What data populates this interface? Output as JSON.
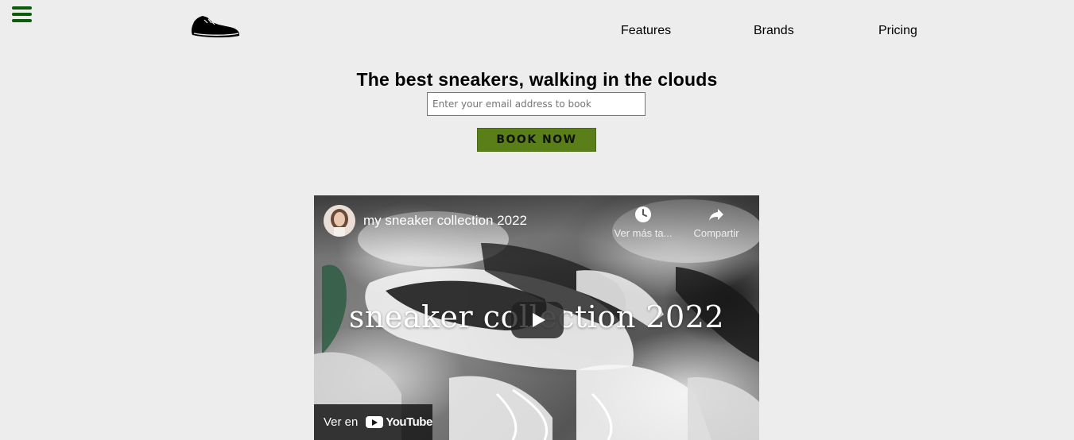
{
  "nav": {
    "menu_icon": "hamburger-icon",
    "logo_icon": "sneaker-logo-icon",
    "links": [
      "Features",
      "Brands",
      "Pricing"
    ]
  },
  "hero": {
    "title": "The best sneakers, walking in the clouds",
    "email_placeholder": "Enter your email address to book",
    "book_label": "BOOK NOW"
  },
  "video": {
    "title": "my sneaker collection 2022",
    "overlay_text": "sneaker collection 2022",
    "watch_later_label": "Ver más ta...",
    "share_label": "Compartir",
    "watch_on_label": "Ver en",
    "youtube_label": "YouTube"
  },
  "colors": {
    "accent_green": "#0b5d0b",
    "button_green": "#5a7e18",
    "background": "#ededed"
  }
}
